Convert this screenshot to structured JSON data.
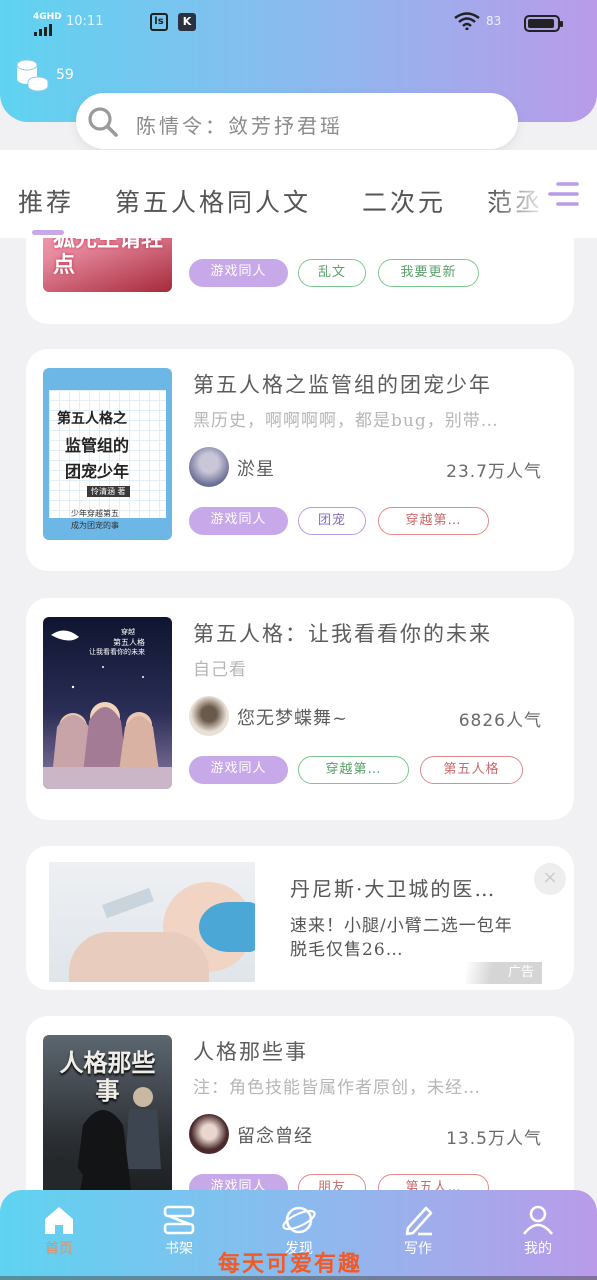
{
  "status": {
    "signal": "4GHD",
    "time": "10:11",
    "app1": "ls",
    "app2": "K",
    "battery": "83"
  },
  "header": {
    "coins": "59",
    "search_placeholder": "陈情令：敛芳抒君瑶"
  },
  "tabs": [
    {
      "label": "推荐",
      "active": true
    },
    {
      "label": "第五人格同人文",
      "active": false
    },
    {
      "label": "二次元",
      "active": false
    },
    {
      "label": "范丞",
      "active": false
    }
  ],
  "books": [
    {
      "cover_text": "狐先生请轻点",
      "tags": [
        {
          "label": "游戏同人",
          "style": "p"
        },
        {
          "label": "乱文",
          "style": "g"
        },
        {
          "label": "我要更新",
          "style": "g"
        }
      ]
    },
    {
      "title": "第五人格之监管组的团宠少年",
      "desc": "黑历史，啊啊啊啊，都是bug，别带…",
      "author": "淤星",
      "popularity": "23.7万人气",
      "cover_lines": [
        "第五人格之",
        "监管组的",
        "团宠少年",
        "少年穿越第五",
        "成为团宠的事"
      ],
      "cover_author": "怜清涵 著",
      "tags": [
        {
          "label": "游戏同人",
          "style": "p"
        },
        {
          "label": "团宠",
          "style": "v"
        },
        {
          "label": "穿越第…",
          "style": "r"
        }
      ]
    },
    {
      "title": "第五人格：让我看看你的未来",
      "desc": "自己看",
      "author": "您无梦蝶舞~",
      "popularity": "6826人气",
      "cover_lines": [
        "穿越",
        "第五人格",
        "让我看看你的未来"
      ],
      "tags": [
        {
          "label": "游戏同人",
          "style": "p"
        },
        {
          "label": "穿越第…",
          "style": "g"
        },
        {
          "label": "第五人格",
          "style": "r"
        }
      ]
    },
    {
      "title": "人格那些事",
      "desc": "注：角色技能皆属作者原创，未经…",
      "author": "留念曾经",
      "popularity": "13.5万人气",
      "cover_text": "人格那些事",
      "tags": [
        {
          "label": "游戏同人",
          "style": "p"
        },
        {
          "label": "朋友",
          "style": "r"
        },
        {
          "label": "第五人…",
          "style": "r"
        }
      ]
    }
  ],
  "ad": {
    "title": "丹尼斯·大卫城的医…",
    "desc": "速来！小腿/小臂二选一包年脱毛仅售26…",
    "badge": "广告",
    "close": "×"
  },
  "nav": [
    {
      "label": "首页",
      "icon": "home-icon",
      "active": true
    },
    {
      "label": "书架",
      "icon": "bookshelf-icon",
      "active": false
    },
    {
      "label": "发现",
      "icon": "planet-icon",
      "active": false
    },
    {
      "label": "写作",
      "icon": "pen-icon",
      "active": false
    },
    {
      "label": "我的",
      "icon": "person-icon",
      "active": false
    }
  ],
  "banner": "每天可爱有趣",
  "colors": {
    "gradient_start": "#5fd3f1",
    "gradient_end": "#b99be9",
    "tag_purple": "#c7a8e8",
    "active_nav": "#f28a5a",
    "banner": "#f05a28"
  }
}
